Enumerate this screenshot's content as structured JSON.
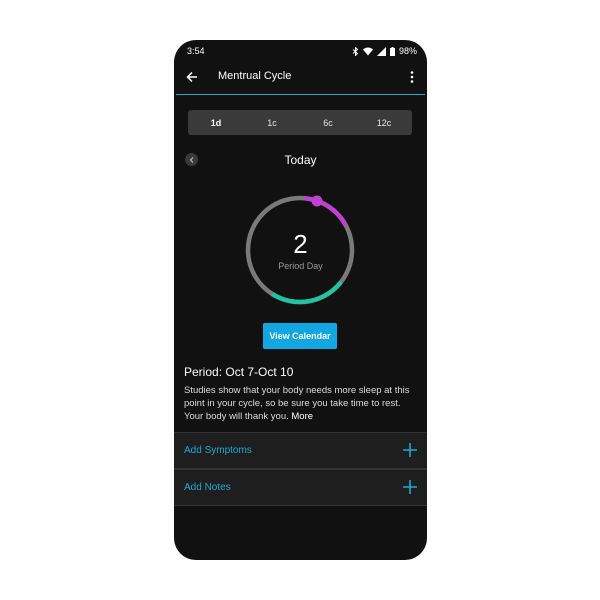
{
  "status_bar": {
    "time": "3:54",
    "battery": "98%"
  },
  "app_bar": {
    "title": "Mentrual Cycle"
  },
  "range_tabs": [
    {
      "label": "1d",
      "active": true
    },
    {
      "label": "1c",
      "active": false
    },
    {
      "label": "6c",
      "active": false
    },
    {
      "label": "12c",
      "active": false
    }
  ],
  "date_nav": {
    "title": "Today"
  },
  "cycle_ring": {
    "day_number": "2",
    "day_label": "Period Day",
    "colors": {
      "track": "#7a7a7a",
      "period": "#c13fd3",
      "fertile": "#1fc4a0"
    }
  },
  "view_calendar_label": "View Calendar",
  "period_info": {
    "title": "Period: Oct 7-Oct 10",
    "description": "Studies show that your body needs more sleep at this point in your cycle, so be sure you take time to rest. Your body will thank you.",
    "more_label": "More"
  },
  "actions": {
    "add_symptoms": "Add Symptoms",
    "add_notes": "Add Notes"
  },
  "colors": {
    "accent": "#12a7e3",
    "background": "#111111"
  }
}
